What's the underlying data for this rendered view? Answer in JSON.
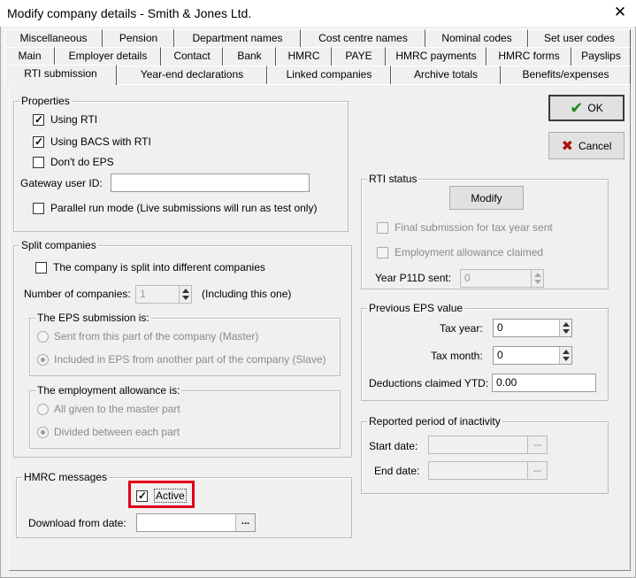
{
  "window": {
    "title": "Modify company details - Smith & Jones Ltd.",
    "close_glyph": "✕"
  },
  "tabs": {
    "row1": [
      "Miscellaneous",
      "Pension",
      "Department names",
      "Cost centre names",
      "Nominal codes",
      "Set user codes"
    ],
    "row2": [
      "Main",
      "Employer details",
      "Contact",
      "Bank",
      "HMRC",
      "PAYE",
      "HMRC payments",
      "HMRC forms",
      "Payslips"
    ],
    "row3": [
      "RTI submission",
      "Year-end declarations",
      "Linked companies",
      "Archive totals",
      "Benefits/expenses"
    ],
    "active": "RTI submission"
  },
  "buttons": {
    "ok": "OK",
    "cancel": "Cancel",
    "modify": "Modify"
  },
  "properties": {
    "legend": "Properties",
    "using_rti": "Using RTI",
    "using_bacs": "Using BACS with RTI",
    "dont_eps": "Don't do EPS",
    "gateway_label": "Gateway user ID:",
    "gateway_value": "",
    "parallel": "Parallel run mode (Live submissions will run as test only)"
  },
  "split": {
    "legend": "Split companies",
    "is_split": "The company is split into different companies",
    "num_label": "Number of companies:",
    "num_value": "1",
    "num_note": "(Including this one)",
    "eps_legend": "The EPS submission is:",
    "eps_master": "Sent from this part of the company (Master)",
    "eps_slave": "Included in EPS from another part of the company (Slave)",
    "ea_legend": "The employment allowance is:",
    "ea_master": "All given to the master part",
    "ea_divided": "Divided between each part"
  },
  "hmrc_messages": {
    "legend": "HMRC messages",
    "active": "Active",
    "download_label": "Download from date:",
    "download_value": ""
  },
  "rti_status": {
    "legend": "RTI status",
    "final_submission": "Final submission for tax year sent",
    "employment_allowance": "Employment allowance claimed",
    "p11d_label": "Year P11D sent:",
    "p11d_value": "0"
  },
  "prev_eps": {
    "legend": "Previous EPS value",
    "tax_year_label": "Tax year:",
    "tax_year_value": "0",
    "tax_month_label": "Tax month:",
    "tax_month_value": "0",
    "deductions_label": "Deductions claimed YTD:",
    "deductions_value": "0.00"
  },
  "inactivity": {
    "legend": "Reported period of inactivity",
    "start_label": "Start date:",
    "start_value": "",
    "end_label": "End date:",
    "end_value": ""
  },
  "glyphs": {
    "check": "✓",
    "ellipsis": "...",
    "ok_mark": "✔",
    "cancel_mark": "✖"
  },
  "colors": {
    "ok_icon": "#1e8c1e",
    "cancel_icon": "#b01010",
    "highlight": "#e2001a"
  }
}
